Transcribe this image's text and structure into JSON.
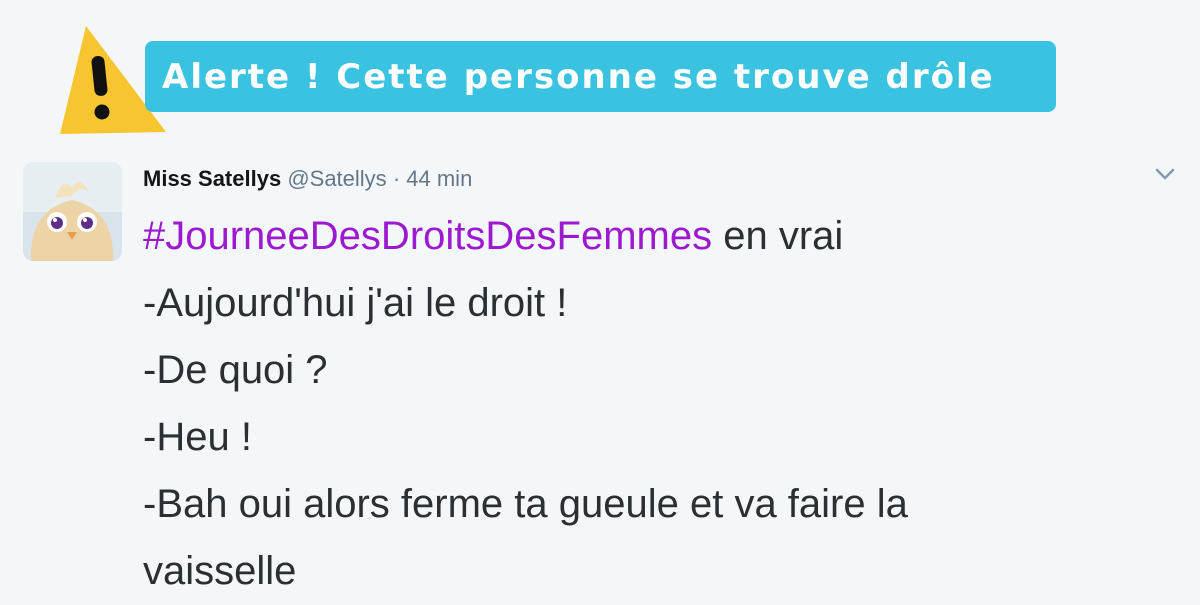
{
  "banner": {
    "text": "Alerte ! Cette personne se trouve drôle",
    "background_color": "#39c3e0",
    "icon": "warning-icon",
    "icon_color": "#f7c52f"
  },
  "tweet": {
    "author_name": "Miss Satellys",
    "handle": "@Satellys",
    "separator": "·",
    "time": "44 min",
    "avatar": "yellow-chick-avatar",
    "menu_icon": "chevron-down-icon",
    "hashtag": "#JourneeDesDroitsDesFemmes",
    "hashtag_color": "#9d19cf",
    "hashtag_suffix": " en vrai",
    "lines": [
      "-Aujourd'hui j'ai le droit !",
      "-De quoi ?",
      "-Heu !",
      "-Bah oui alors ferme ta gueule et va faire la",
      "vaisselle"
    ]
  }
}
